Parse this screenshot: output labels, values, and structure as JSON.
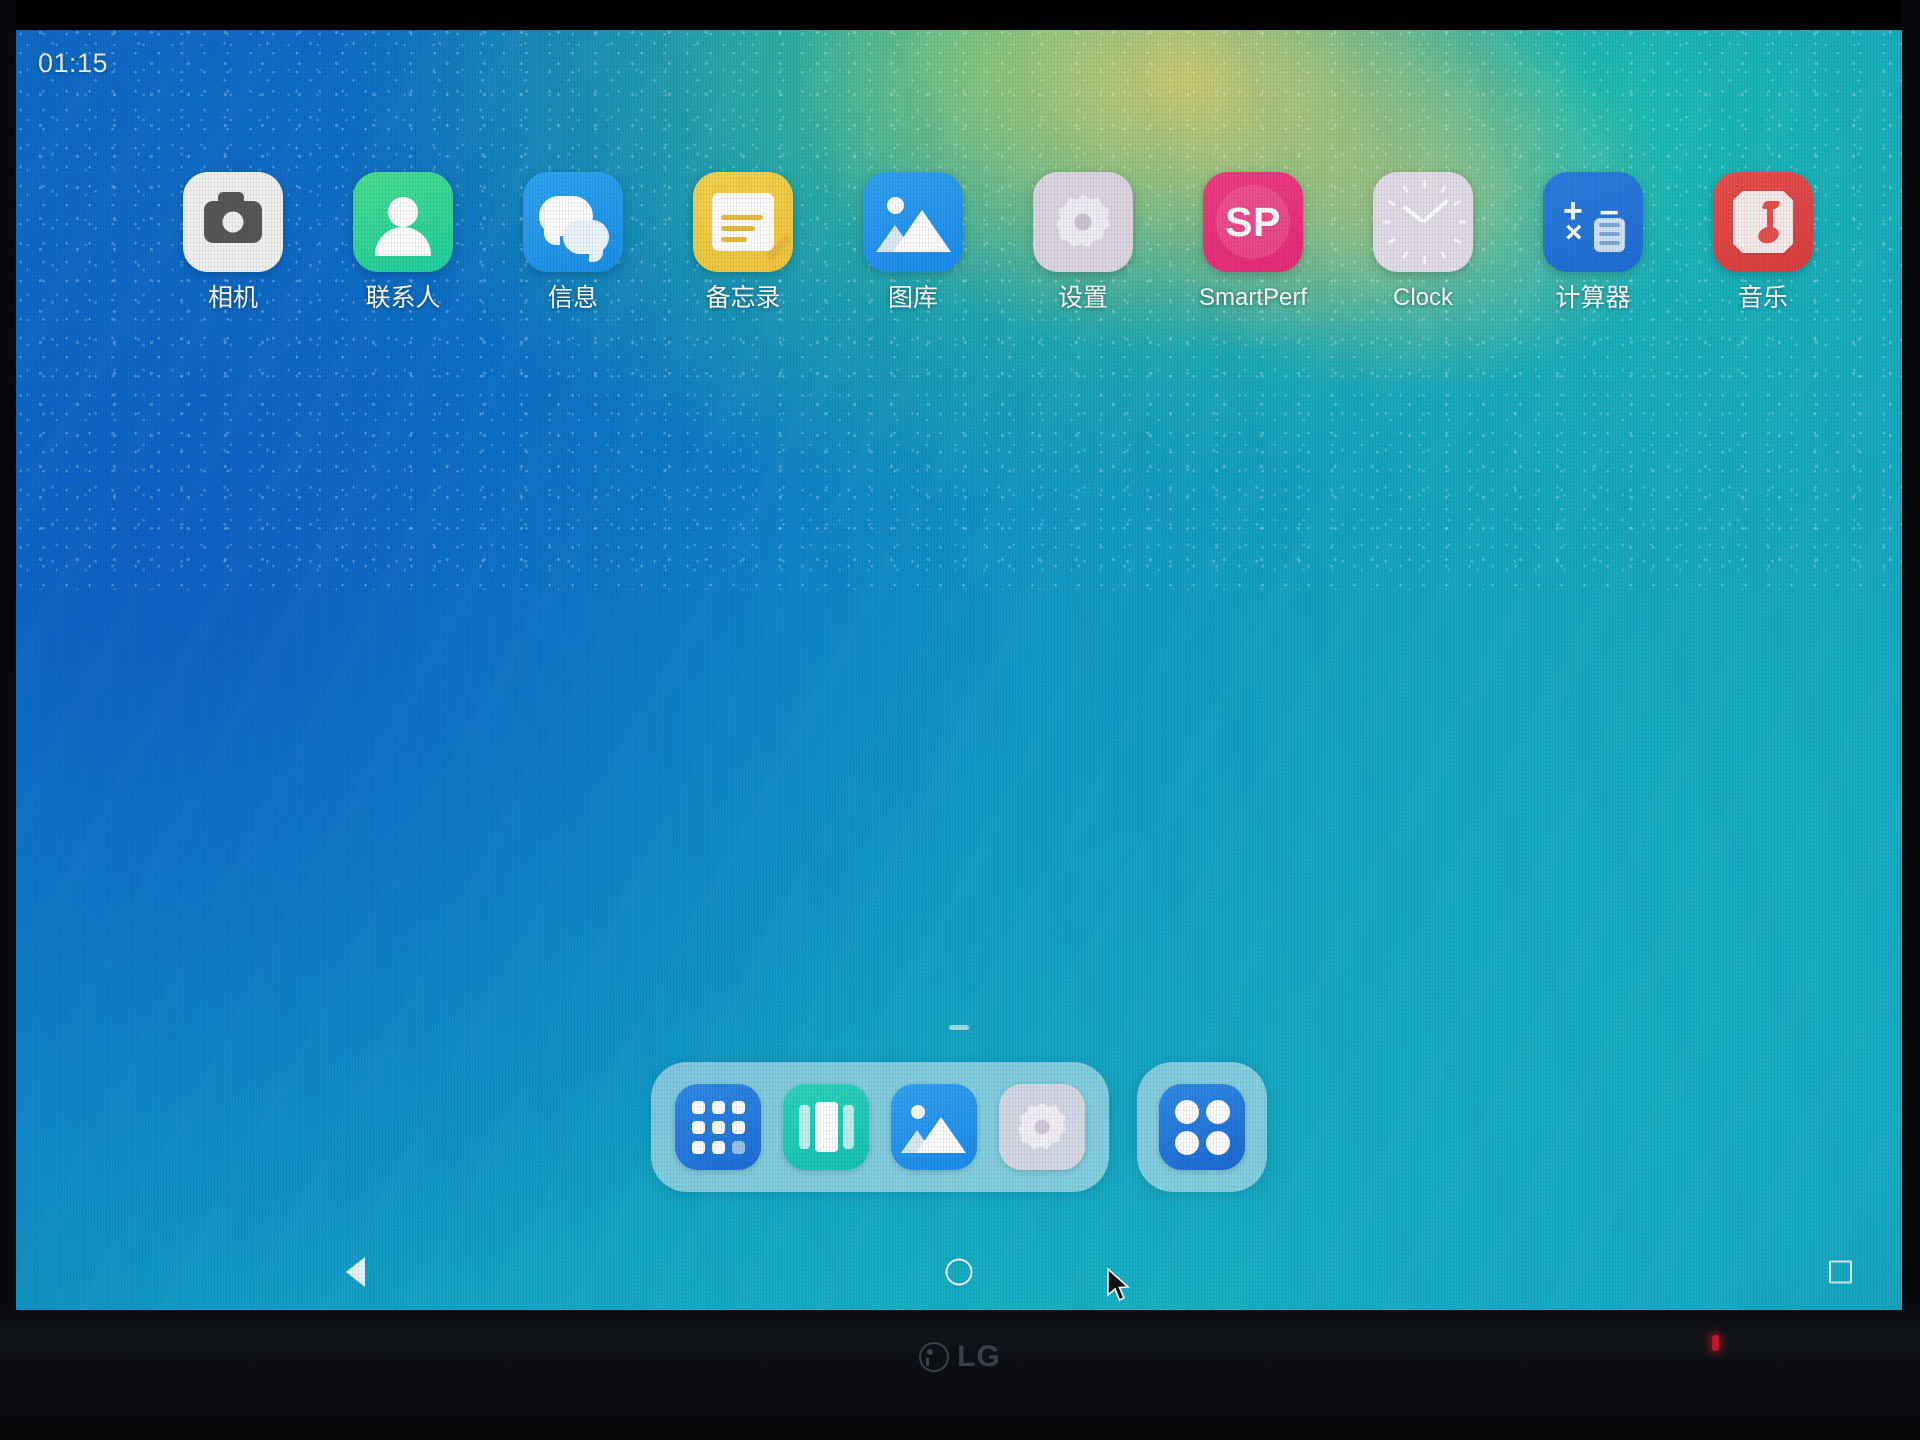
{
  "device": {
    "monitor_brand": "LG",
    "power_led_color": "#c0182a"
  },
  "status_bar": {
    "clock": "01:15"
  },
  "home_screen": {
    "apps": [
      {
        "label": "相机",
        "icon": "camera-icon",
        "bg": "#f1f1ef"
      },
      {
        "label": "联系人",
        "icon": "contacts-icon",
        "bg": "#2fd594"
      },
      {
        "label": "信息",
        "icon": "messages-icon",
        "bg": "#2296ea"
      },
      {
        "label": "备忘录",
        "icon": "notes-icon",
        "bg": "#f3cc45"
      },
      {
        "label": "图库",
        "icon": "gallery-icon",
        "bg": "#2494ef"
      },
      {
        "label": "设置",
        "icon": "settings-gear-icon",
        "bg": "#dcd7e2"
      },
      {
        "label": "SmartPerf",
        "icon": "smartperf-icon",
        "bg": "#e8327c"
      },
      {
        "label": "Clock",
        "icon": "clock-icon",
        "bg": "#e2dde8"
      },
      {
        "label": "计算器",
        "icon": "calculator-icon",
        "bg": "#2474da"
      },
      {
        "label": "音乐",
        "icon": "music-icon",
        "bg": "#e04444"
      }
    ],
    "smartperf_badge": "SP"
  },
  "dock": {
    "tray_items": [
      {
        "name": "app-grid-icon",
        "bg": "#2a80e0"
      },
      {
        "name": "columns-icon",
        "bg": "#20cbba"
      },
      {
        "name": "gallery-icon",
        "bg": "#2494ef"
      },
      {
        "name": "settings-gear-icon",
        "bg": "#e2dbe7"
      }
    ],
    "drawer_item": {
      "name": "app-drawer-icon",
      "bg": "#2474da"
    }
  },
  "nav_bar": {
    "back": "back-triangle-icon",
    "home": "home-circle-icon",
    "recents": "recents-square-icon"
  },
  "cursor": {
    "visible": "true"
  }
}
